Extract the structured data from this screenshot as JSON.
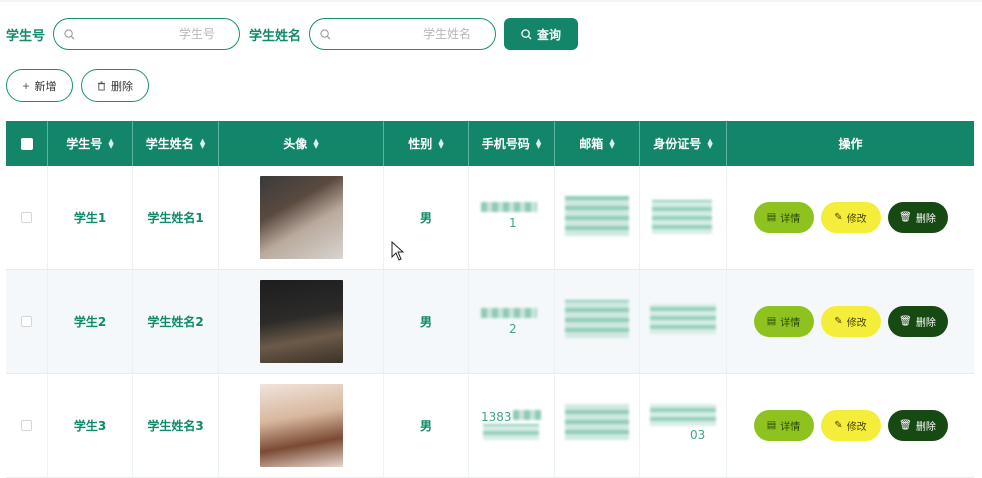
{
  "search": {
    "field1_label": "学生号",
    "field1_placeholder": "学生号",
    "field2_label": "学生姓名",
    "field2_placeholder": "学生姓名",
    "query_label": "查询"
  },
  "actions": {
    "add_label": "新增",
    "delete_label": "删除"
  },
  "table": {
    "columns": [
      "学生号",
      "学生姓名",
      "头像",
      "性别",
      "手机号码",
      "邮箱",
      "身份证号",
      "操作"
    ],
    "rows": [
      {
        "student_no": "学生1",
        "student_name": "学生姓名1",
        "gender": "男",
        "phone_fragment": "1",
        "id_fragment": ""
      },
      {
        "student_no": "学生2",
        "student_name": "学生姓名2",
        "gender": "男",
        "phone_fragment": "2",
        "id_fragment": ""
      },
      {
        "student_no": "学生3",
        "student_name": "学生姓名3",
        "gender": "男",
        "phone_fragment": "1383",
        "id_fragment": "03"
      }
    ],
    "ops": {
      "detail": "详情",
      "edit": "修改",
      "delete": "删除"
    }
  },
  "colors": {
    "primary": "#13866a",
    "detail": "#8dc21f",
    "edit": "#f4ee3b",
    "delete": "#174a12"
  }
}
